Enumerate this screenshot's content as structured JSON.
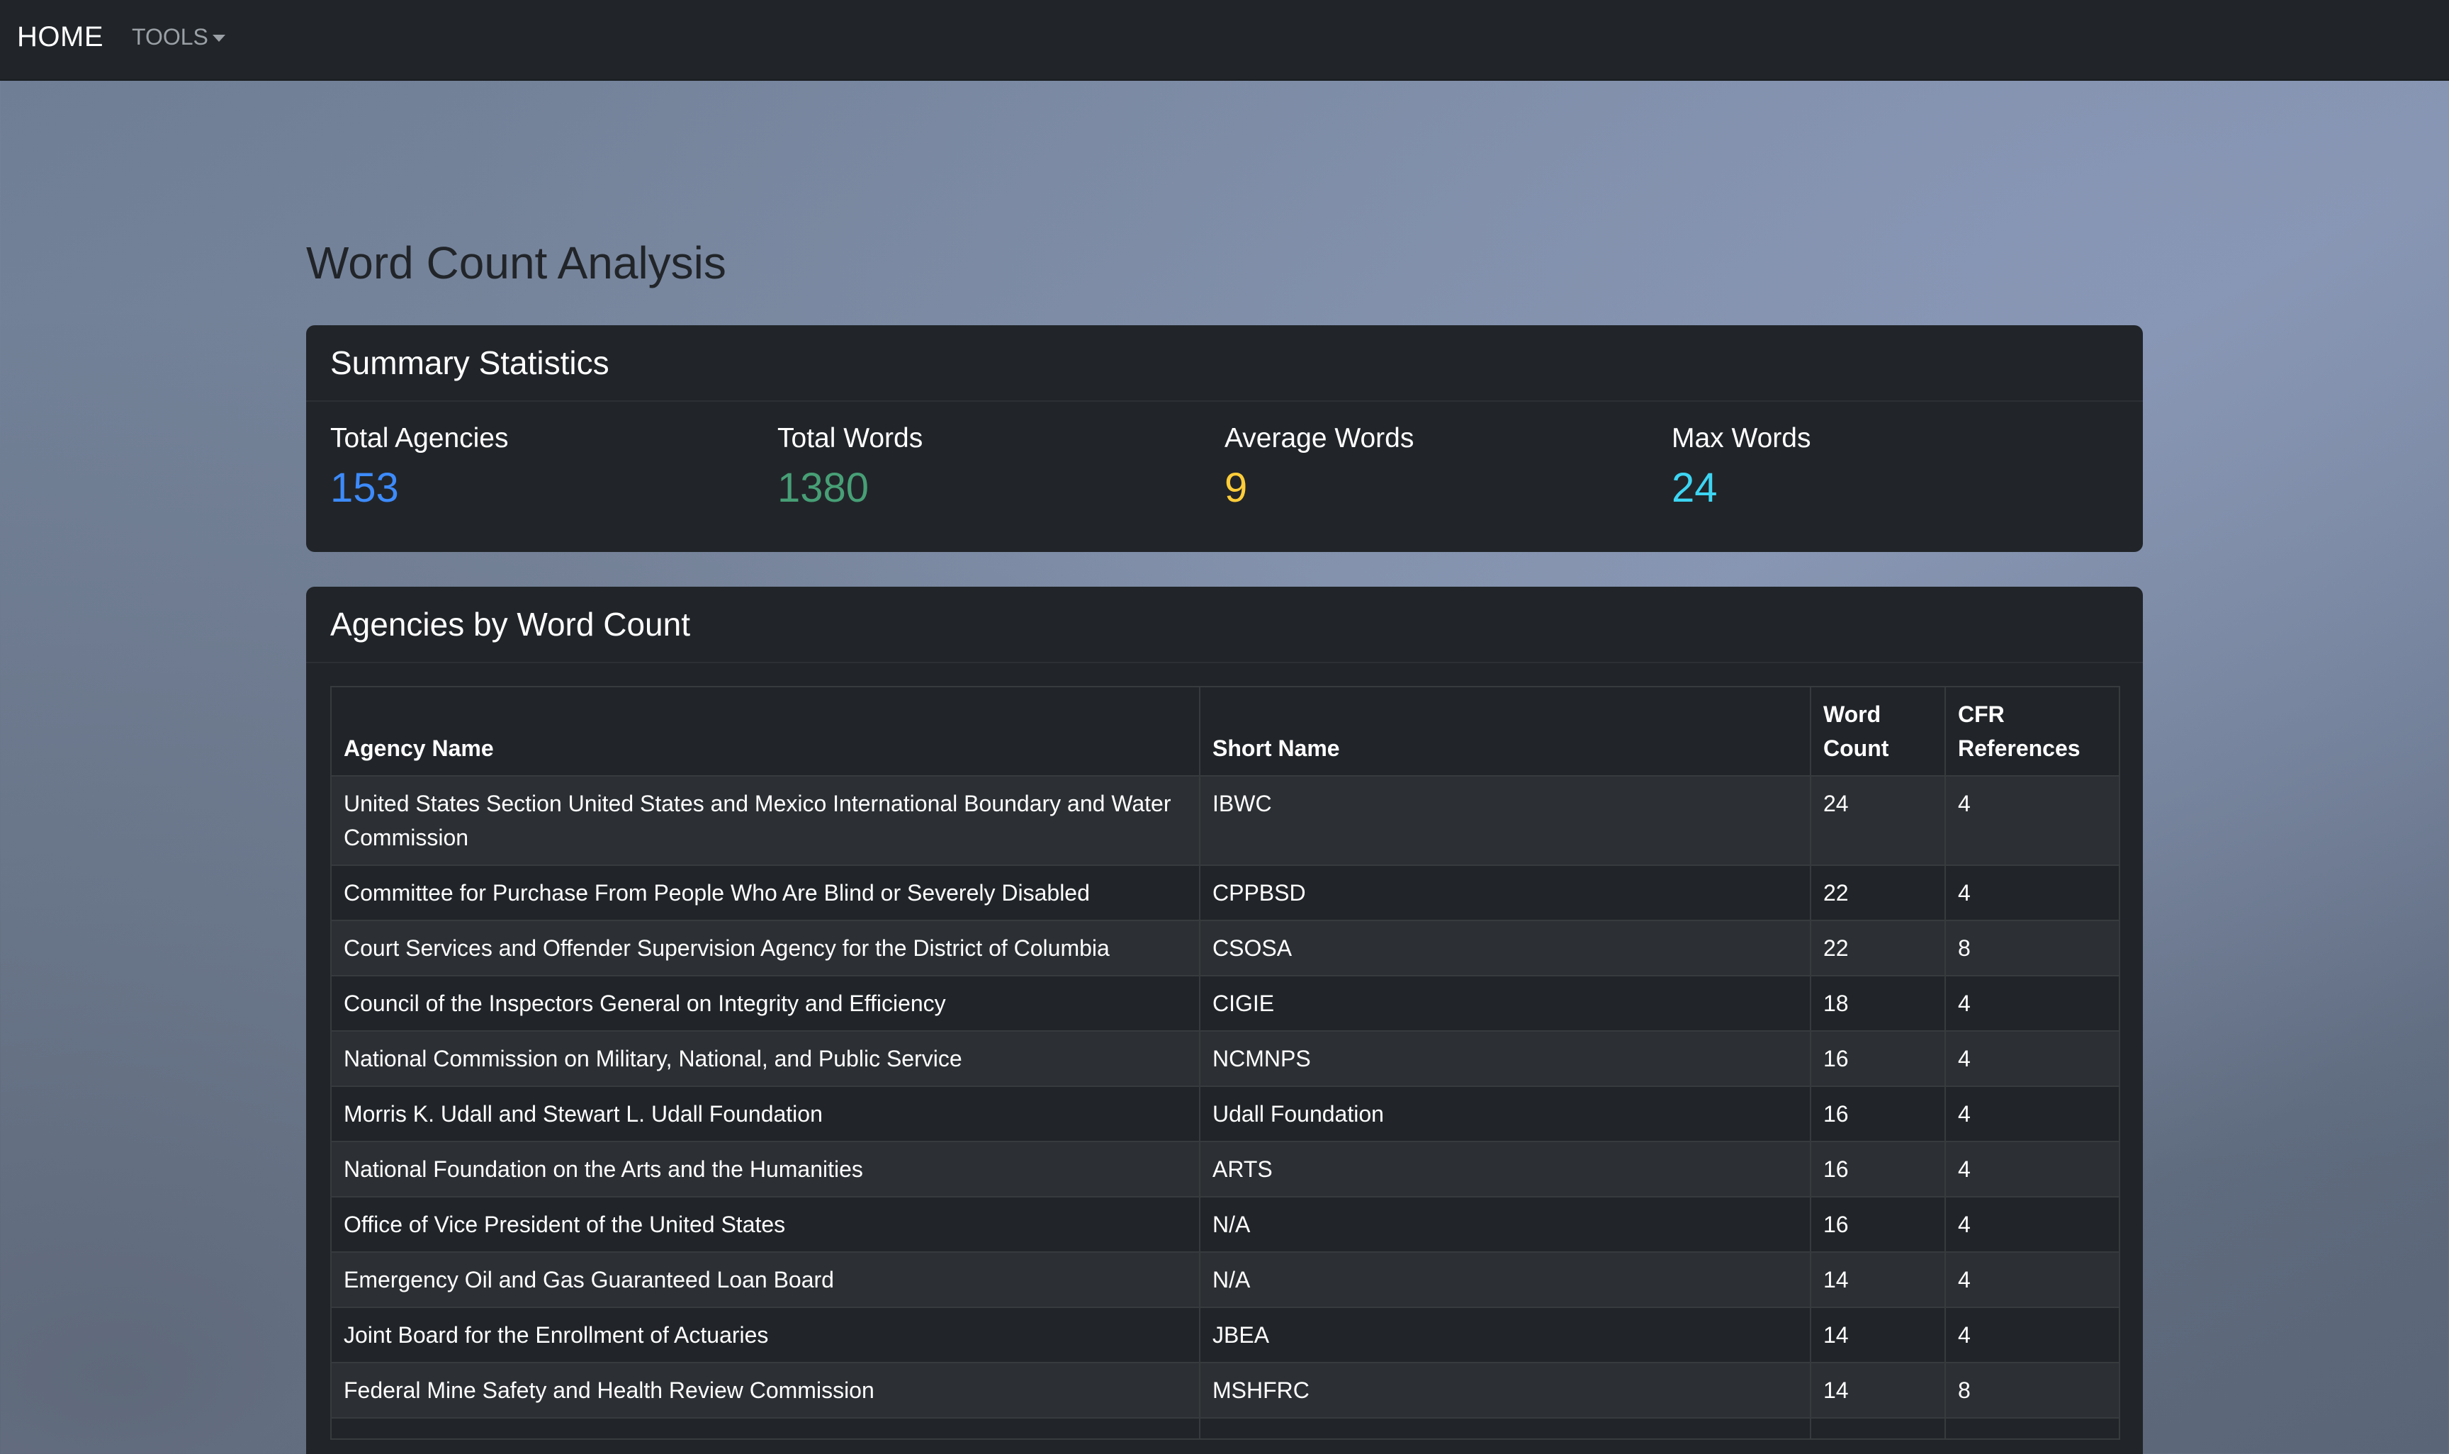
{
  "nav": {
    "brand": "HOME",
    "tools": "TOOLS"
  },
  "page": {
    "title": "Word Count Analysis"
  },
  "summary": {
    "header": "Summary Statistics",
    "stats": [
      {
        "label": "Total Agencies",
        "value": "153",
        "color": "#3d8bfd"
      },
      {
        "label": "Total Words",
        "value": "1380",
        "color": "#479f76"
      },
      {
        "label": "Average Words",
        "value": "9",
        "color": "#ffcd39"
      },
      {
        "label": "Max Words",
        "value": "24",
        "color": "#3dd5f3"
      }
    ]
  },
  "agencies": {
    "header": "Agencies by Word Count",
    "columns": [
      "Agency Name",
      "Short Name",
      "Word Count",
      "CFR References"
    ],
    "rows": [
      [
        "United States Section United States and Mexico International Boundary and Water Commission",
        "IBWC",
        "24",
        "4"
      ],
      [
        "Committee for Purchase From People Who Are Blind or Severely Disabled",
        "CPPBSD",
        "22",
        "4"
      ],
      [
        "Court Services and Offender Supervision Agency for the District of Columbia",
        "CSOSA",
        "22",
        "8"
      ],
      [
        "Council of the Inspectors General on Integrity and Efficiency",
        "CIGIE",
        "18",
        "4"
      ],
      [
        "National Commission on Military, National, and Public Service",
        "NCMNPS",
        "16",
        "4"
      ],
      [
        "Morris K. Udall and Stewart L. Udall Foundation",
        "Udall Foundation",
        "16",
        "4"
      ],
      [
        "National Foundation on the Arts and the Humanities",
        "ARTS",
        "16",
        "4"
      ],
      [
        "Office of Vice President of the United States",
        "N/A",
        "16",
        "4"
      ],
      [
        "Emergency Oil and Gas Guaranteed Loan Board",
        "N/A",
        "14",
        "4"
      ],
      [
        "Joint Board for the Enrollment of Actuaries",
        "JBEA",
        "14",
        "4"
      ],
      [
        "Federal Mine Safety and Health Review Commission",
        "MSHFRC",
        "14",
        "8"
      ],
      [
        "",
        "",
        "",
        ""
      ]
    ]
  }
}
